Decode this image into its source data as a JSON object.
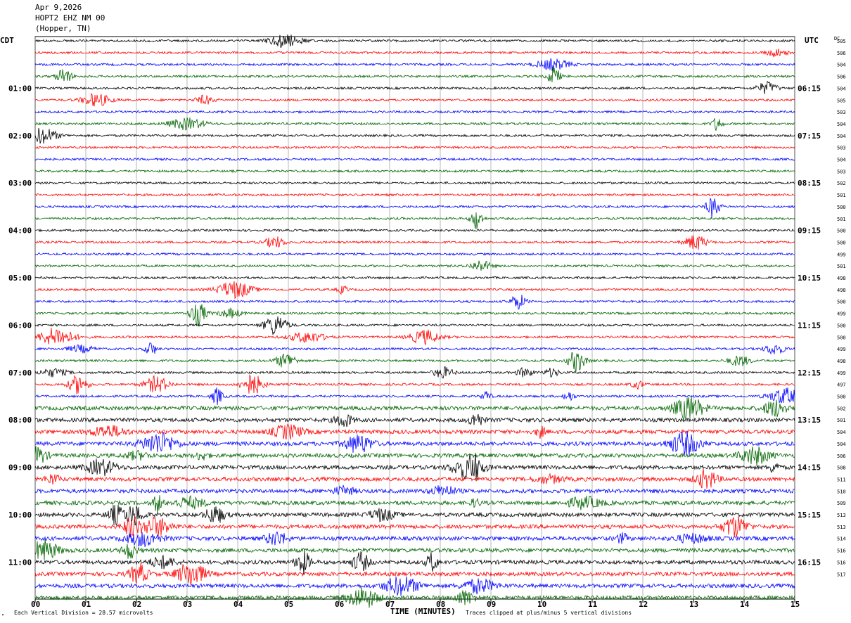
{
  "header": {
    "date": "Apr 9,2026",
    "station": "HOPT2 EHZ NM 00",
    "location": "(Hopper, TN)"
  },
  "left_tz": "CDT",
  "right_tz": "UTC",
  "dc_label": "DC",
  "footer": {
    "division": "Each Vertical Division =   28.57 microvolts",
    "clip_note": "Traces clipped at plus/minus 5 vertical divisions",
    "corner_mark": "ᴹ"
  },
  "chart_data": {
    "type": "seismogram",
    "xlabel": "TIME (MINUTES)",
    "x_ticks": [
      "00",
      "01",
      "02",
      "03",
      "04",
      "05",
      "06",
      "07",
      "08",
      "09",
      "10",
      "11",
      "12",
      "13",
      "14",
      "15"
    ],
    "xlim": [
      0,
      15
    ],
    "trace_colors": [
      "#000000",
      "#ff0000",
      "#0000ff",
      "#006400"
    ],
    "left_hour_labels": [
      "01:00",
      "02:00",
      "03:00",
      "04:00",
      "05:00",
      "06:00",
      "07:00",
      "08:00",
      "09:00",
      "10:00",
      "11:00"
    ],
    "right_hour_labels": [
      "06:15",
      "07:15",
      "08:15",
      "09:15",
      "10:15",
      "11:15",
      "12:15",
      "13:15",
      "14:15",
      "15:15",
      "16:15"
    ],
    "dc_offsets": [
      "505",
      "506",
      "504",
      "506",
      "504",
      "505",
      "503",
      "504",
      "504",
      "503",
      "504",
      "503",
      "502",
      "501",
      "500",
      "501",
      "500",
      "500",
      "499",
      "501",
      "498",
      "498",
      "500",
      "499",
      "500",
      "500",
      "499",
      "498",
      "499",
      "497",
      "500",
      "502",
      "501",
      "504",
      "504",
      "506",
      "508",
      "511",
      "510",
      "509",
      "513",
      "513",
      "514",
      "516",
      "516",
      "517"
    ],
    "n_traces": 48,
    "minutes_per_trace": 15
  }
}
